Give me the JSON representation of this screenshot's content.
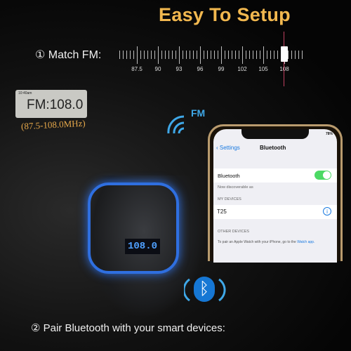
{
  "title": "Easy To Setup",
  "step1": {
    "label": "① Match FM:",
    "scale_labels": [
      "87.5",
      "90",
      "93",
      "96",
      "99",
      "102",
      "105",
      "108"
    ],
    "selected": "108"
  },
  "radio": {
    "display": "FM:108.0",
    "time": "10:40am",
    "range": "(87.5-108.0MHz)"
  },
  "fm_label": "FM",
  "phone": {
    "battery": "78%",
    "back": "Settings",
    "title": "Bluetooth",
    "bluetooth_label": "Bluetooth",
    "bluetooth_on": true,
    "discoverable": "Now discoverable as",
    "my_devices_header": "MY DEVICES",
    "device": "T25",
    "other_devices_header": "OTHER DEVICES",
    "watch_note": "To pair an Apple Watch with your iPhone, go to the",
    "watch_link": "Watch app."
  },
  "device_display": "108.0",
  "step2": "② Pair Bluetooth with your smart devices:",
  "colors": {
    "title": "#f2b84f",
    "accent_blue": "#2f6fe0",
    "toggle": "#4cd964"
  }
}
